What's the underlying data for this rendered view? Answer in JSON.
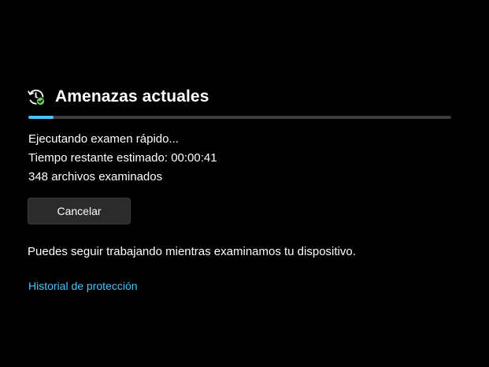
{
  "section": {
    "title": "Amenazas actuales",
    "icon": "refresh-clock-check-icon"
  },
  "scan": {
    "progress_fraction": 0.06,
    "status": "Ejecutando examen rápido...",
    "time_remaining": "Tiempo restante estimado: 00:00:41",
    "files_scanned": "348 archivos examinados"
  },
  "actions": {
    "cancel_label": "Cancelar"
  },
  "info": {
    "text": "Puedes seguir trabajando mientras examinamos tu dispositivo."
  },
  "links": {
    "history_label": "Historial de protección"
  },
  "colors": {
    "background": "#000000",
    "accent": "#4cc2ff",
    "check": "#6ccb5f",
    "track": "#3c3c3c",
    "button": "#2b2b2b"
  }
}
